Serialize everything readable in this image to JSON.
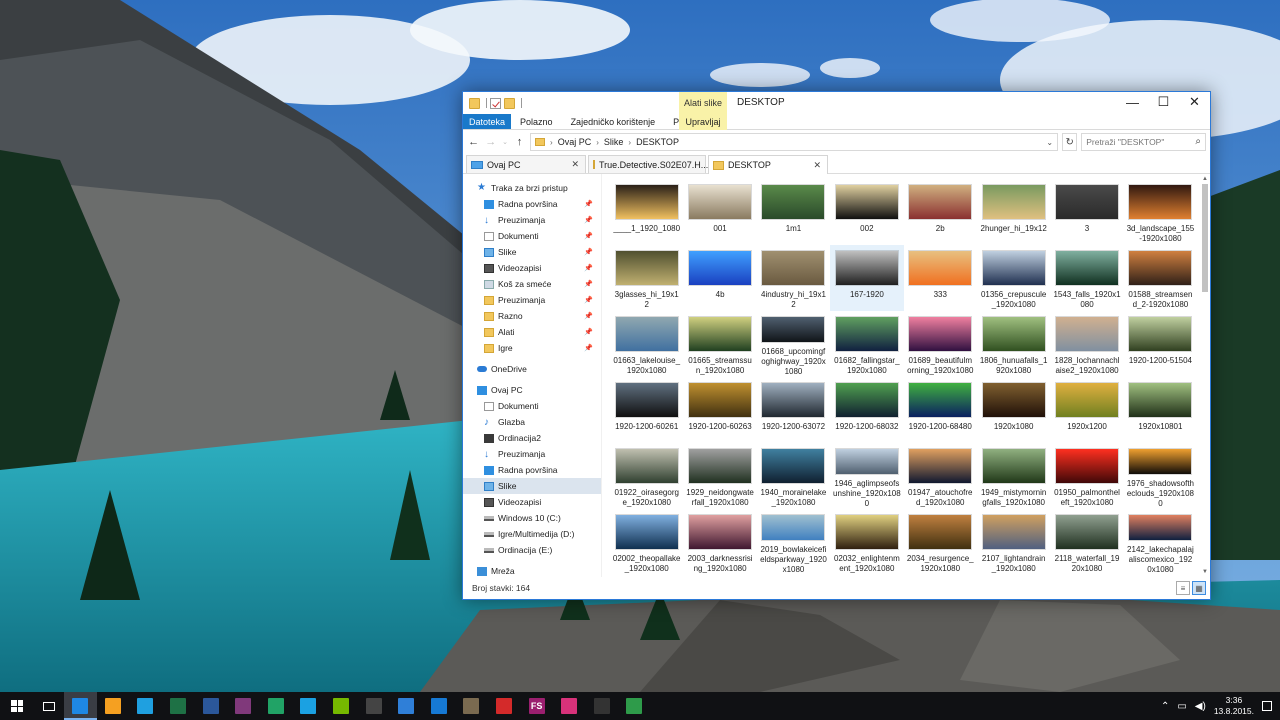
{
  "window": {
    "title": "DESKTOP",
    "context_tab": "Alati slike",
    "controls": {
      "minimize": "—",
      "maximize": "☐",
      "close": "✕"
    }
  },
  "ribbon": {
    "tabs": [
      "Datoteka",
      "Polazno",
      "Zajedničko korištenje",
      "Prikaz"
    ],
    "context_tab": "Upravljaj"
  },
  "address": {
    "crumbs": [
      "Ovaj PC",
      "Slike",
      "DESKTOP"
    ],
    "search_placeholder": "Pretraži \"DESKTOP\""
  },
  "tabs": [
    {
      "label": "Ovaj PC",
      "icon": "pc-icon",
      "active": false
    },
    {
      "label": "True.Detective.S02E07.H...",
      "icon": "folder-icon",
      "active": false
    },
    {
      "label": "DESKTOP",
      "icon": "folder-icon",
      "active": true
    }
  ],
  "navpane": [
    {
      "label": "Traka za brzi pristup",
      "level": 1,
      "icon": "star"
    },
    {
      "label": "Radna površina",
      "level": 2,
      "icon": "blue",
      "pinned": true
    },
    {
      "label": "Preuzimanja",
      "level": 2,
      "icon": "down",
      "pinned": true
    },
    {
      "label": "Dokumenti",
      "level": 2,
      "icon": "doc",
      "pinned": true
    },
    {
      "label": "Slike",
      "level": 2,
      "icon": "pics",
      "pinned": true
    },
    {
      "label": "Videozapisi",
      "level": 2,
      "icon": "vid",
      "pinned": true
    },
    {
      "label": "Koš za smeće",
      "level": 2,
      "icon": "trash",
      "pinned": true
    },
    {
      "label": "Preuzimanja",
      "level": 2,
      "icon": "yellow",
      "pinned": true
    },
    {
      "label": "Razno",
      "level": 2,
      "icon": "yellow",
      "pinned": true
    },
    {
      "label": "Alati",
      "level": 2,
      "icon": "yellow",
      "pinned": true
    },
    {
      "label": "Igre",
      "level": 2,
      "icon": "yellow",
      "pinned": true
    },
    {
      "label": "OneDrive",
      "level": 1,
      "icon": "cloud",
      "gap": true
    },
    {
      "label": "Ovaj PC",
      "level": 1,
      "icon": "blue",
      "gap": true
    },
    {
      "label": "Dokumenti",
      "level": 2,
      "icon": "doc"
    },
    {
      "label": "Glazba",
      "level": 2,
      "icon": "music"
    },
    {
      "label": "Ordinacija2",
      "level": 2,
      "icon": "dark"
    },
    {
      "label": "Preuzimanja",
      "level": 2,
      "icon": "down"
    },
    {
      "label": "Radna površina",
      "level": 2,
      "icon": "blue"
    },
    {
      "label": "Slike",
      "level": 2,
      "icon": "pics",
      "selected": true
    },
    {
      "label": "Videozapisi",
      "level": 2,
      "icon": "vid"
    },
    {
      "label": "Windows 10 (C:)",
      "level": 2,
      "icon": "drive"
    },
    {
      "label": "Igre/Multimedija (D:)",
      "level": 2,
      "icon": "drive"
    },
    {
      "label": "Ordinacija (E:)",
      "level": 2,
      "icon": "drive"
    },
    {
      "label": "Mreža",
      "level": 1,
      "icon": "net",
      "gap": true
    }
  ],
  "files": [
    {
      "name": "____1_1920_1080",
      "c1": "#f0c060",
      "c2": "#2a2018"
    },
    {
      "name": "001",
      "c1": "#8a7a60",
      "c2": "#e8e0d0"
    },
    {
      "name": "1m1",
      "c1": "#2a4a2a",
      "c2": "#5a8a4a"
    },
    {
      "name": "002",
      "c1": "#101010",
      "c2": "#e0d0a0"
    },
    {
      "name": "2b",
      "c1": "#8a3030",
      "c2": "#d0b080"
    },
    {
      "name": "2hunger_hi_19x12",
      "c1": "#e0c080",
      "c2": "#7a9a60"
    },
    {
      "name": "3",
      "c1": "#2a2a2a",
      "c2": "#4a4a4a"
    },
    {
      "name": "3d_landscape_155-1920x1080",
      "c1": "#e08030",
      "c2": "#301810"
    },
    {
      "name": "3glasses_hi_19x12",
      "c1": "#c0b070",
      "c2": "#505030"
    },
    {
      "name": "4b",
      "c1": "#1a40c0",
      "c2": "#40a0ff"
    },
    {
      "name": "4industry_hi_19x12",
      "c1": "#6a5a40",
      "c2": "#a09070"
    },
    {
      "name": "167-1920",
      "c1": "#202020",
      "c2": "#c0c0c0",
      "sel": true
    },
    {
      "name": "333",
      "c1": "#f07020",
      "c2": "#e8c080"
    },
    {
      "name": "01356_crepuscule_1920x1080",
      "c1": "#203050",
      "c2": "#c0d0e0"
    },
    {
      "name": "1543_falls_1920x1080",
      "c1": "#103020",
      "c2": "#80b0a0"
    },
    {
      "name": "01588_streamsend_2-1920x1080",
      "c1": "#302018",
      "c2": "#d08040"
    },
    {
      "name": "01663_lakelouise_1920x1080",
      "c1": "#4070a0",
      "c2": "#90a8b0"
    },
    {
      "name": "01665_streamssun_1920x1080",
      "c1": "#204020",
      "c2": "#d0d080"
    },
    {
      "name": "01668_upcomingfoghighway_1920x1080",
      "c1": "#101418",
      "c2": "#506070"
    },
    {
      "name": "01682_fallingstar_1920x1080",
      "c1": "#102040",
      "c2": "#60a060"
    },
    {
      "name": "01689_beautifulmorning_1920x1080",
      "c1": "#301040",
      "c2": "#f080a0"
    },
    {
      "name": "1806_hunuafalls_1920x1080",
      "c1": "#305020",
      "c2": "#a0c080"
    },
    {
      "name": "1828_lochannachlaise2_1920x1080",
      "c1": "#8090a0",
      "c2": "#d0b090"
    },
    {
      "name": "1920-1200-51504",
      "c1": "#304020",
      "c2": "#c0d0a0"
    },
    {
      "name": "1920-1200-60261",
      "c1": "#101010",
      "c2": "#607080"
    },
    {
      "name": "1920-1200-60263",
      "c1": "#403010",
      "c2": "#c09030"
    },
    {
      "name": "1920-1200-63072",
      "c1": "#202830",
      "c2": "#a0b0c0"
    },
    {
      "name": "1920-1200-68032",
      "c1": "#102030",
      "c2": "#50a050"
    },
    {
      "name": "1920-1200-68480",
      "c1": "#0a2060",
      "c2": "#40b040"
    },
    {
      "name": "1920x1080",
      "c1": "#201008",
      "c2": "#806030"
    },
    {
      "name": "1920x1200",
      "c1": "#708020",
      "c2": "#e0b040"
    },
    {
      "name": "1920x10801",
      "c1": "#203018",
      "c2": "#a0c080"
    },
    {
      "name": "01922_oirasegorge_1920x1080",
      "c1": "#304030",
      "c2": "#c0c0b0"
    },
    {
      "name": "1929_neidongwaterfall_1920x1080",
      "c1": "#203020",
      "c2": "#a0a0a0"
    },
    {
      "name": "1940_morainelake_1920x1080",
      "c1": "#102030",
      "c2": "#4080a0"
    },
    {
      "name": "1946_aglimpseofsunshine_1920x1080",
      "c1": "#506070",
      "c2": "#c0d0e0"
    },
    {
      "name": "01947_atouchofred_1920x1080",
      "c1": "#101830",
      "c2": "#e0a060"
    },
    {
      "name": "1949_mistymorningfalls_1920x1080",
      "c1": "#203818",
      "c2": "#90b080"
    },
    {
      "name": "01950_palmontheleft_1920x1080",
      "c1": "#400808",
      "c2": "#ff3020"
    },
    {
      "name": "1976_shadowsoftheclouds_1920x1080",
      "c1": "#100c08",
      "c2": "#f0a030"
    },
    {
      "name": "02002_theopallake_1920x1080",
      "c1": "#103050",
      "c2": "#80b0e0"
    },
    {
      "name": "2003_darknessrising_1920x1080",
      "c1": "#401830",
      "c2": "#e0a0a0"
    },
    {
      "name": "2019_bowlakeicefieldsparkway_1920x1080",
      "c1": "#4080c0",
      "c2": "#a0c0d0"
    },
    {
      "name": "02032_enlightenment_1920x1080",
      "c1": "#302010",
      "c2": "#e0d080"
    },
    {
      "name": "2034_resurgence_1920x1080",
      "c1": "#403010",
      "c2": "#c08040"
    },
    {
      "name": "2107_lightandrain_1920x1080",
      "c1": "#506080",
      "c2": "#d0a060"
    },
    {
      "name": "2118_waterfall_1920x1080",
      "c1": "#203020",
      "c2": "#90a090"
    },
    {
      "name": "2142_lakechapalajaliscomexico_1920x1080",
      "c1": "#102040",
      "c2": "#e08060"
    }
  ],
  "status": {
    "count": "Broj stavki: 164"
  },
  "taskbar": {
    "apps": [
      {
        "name": "file-explorer",
        "color": "#1e88e5",
        "glyph": "",
        "active": true
      },
      {
        "name": "firefox",
        "color": "#f5a021",
        "glyph": ""
      },
      {
        "name": "notepad",
        "color": "#1fa0e0",
        "glyph": ""
      },
      {
        "name": "excel",
        "color": "#1e7145",
        "glyph": ""
      },
      {
        "name": "word",
        "color": "#2b579a",
        "glyph": ""
      },
      {
        "name": "onenote",
        "color": "#80397b",
        "glyph": ""
      },
      {
        "name": "app-green",
        "color": "#21a366",
        "glyph": ""
      },
      {
        "name": "app-teal",
        "color": "#1ba1e2",
        "glyph": ""
      },
      {
        "name": "nvidia",
        "color": "#76b900",
        "glyph": ""
      },
      {
        "name": "app-check",
        "color": "#444",
        "glyph": ""
      },
      {
        "name": "app-blue",
        "color": "#2f7fd8",
        "glyph": ""
      },
      {
        "name": "app-store",
        "color": "#1679d4",
        "glyph": ""
      },
      {
        "name": "app-grey",
        "color": "#7a6a50",
        "glyph": ""
      },
      {
        "name": "app-red",
        "color": "#d42a2a",
        "glyph": ""
      },
      {
        "name": "fs",
        "color": "#9b1f6f",
        "glyph": "FS"
      },
      {
        "name": "app-pink",
        "color": "#d8327a",
        "glyph": ""
      },
      {
        "name": "app-dark",
        "color": "#333",
        "glyph": ""
      },
      {
        "name": "app-green2",
        "color": "#2e9b4a",
        "glyph": ""
      }
    ],
    "clock_time": "3:36",
    "clock_date": "13.8.2015."
  }
}
